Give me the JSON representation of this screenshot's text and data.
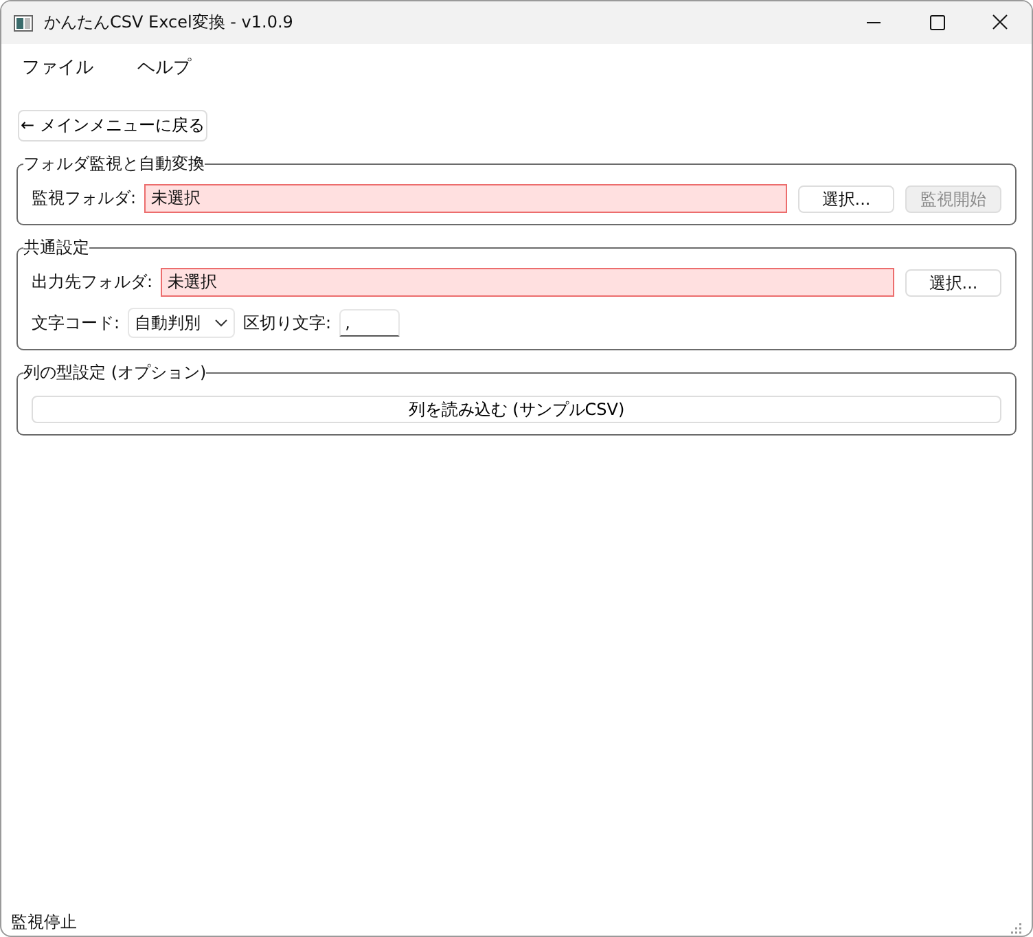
{
  "window": {
    "title": "かんたんCSV Excel変換 - v1.0.9"
  },
  "menu": [
    {
      "label": "ファイル"
    },
    {
      "label": "ヘルプ"
    }
  ],
  "back_button": {
    "label": "← メインメニューに戻る"
  },
  "watch_group": {
    "title": "フォルダ監視と自動変換",
    "label": "監視フォルダ:",
    "value": "未選択",
    "invalid": true,
    "buttons": [
      {
        "label": "選択...",
        "disabled": false
      },
      {
        "label": "監視開始",
        "disabled": true
      }
    ]
  },
  "common_group": {
    "title": "共通設定",
    "output": {
      "label": "出力先フォルダ:",
      "value": "未選択",
      "invalid": true,
      "button": {
        "label": "選択...",
        "disabled": false
      }
    },
    "encoding": {
      "label": "文字コード:",
      "value": "自動判別"
    },
    "delimiter": {
      "label": "区切り文字:",
      "value": ","
    }
  },
  "columns_group": {
    "title": "列の型設定 (オプション)",
    "button": {
      "label": "列を読み込む (サンプルCSV)"
    }
  },
  "status_bar": {
    "text": "監視停止"
  }
}
